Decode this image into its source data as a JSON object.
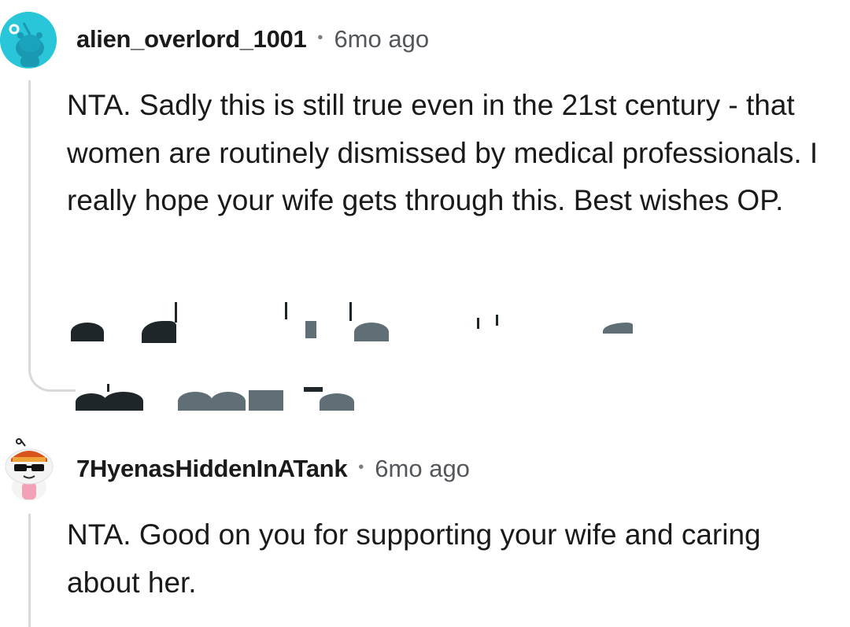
{
  "comments": [
    {
      "username": "alien_overlord_1001",
      "separator": "•",
      "time": "6mo ago",
      "avatar_icon": "snoo-avatar-cyan",
      "body": "NTA. Sadly this is still true even in the 21st century - that women are routinely dismissed by medical professionals. I really hope your wife gets through this. Best wishes OP."
    },
    {
      "username": "7HyenasHiddenInATank",
      "separator": "•",
      "time": "6mo ago",
      "avatar_icon": "snoo-avatar-sunglasses",
      "body": "NTA. Good on you for supporting your wife and caring about her."
    }
  ],
  "colors": {
    "avatar_cyan": "#29c6d9",
    "thread_line": "#d9d9d9",
    "text": "#1a1a1b",
    "meta": "#53575b"
  }
}
